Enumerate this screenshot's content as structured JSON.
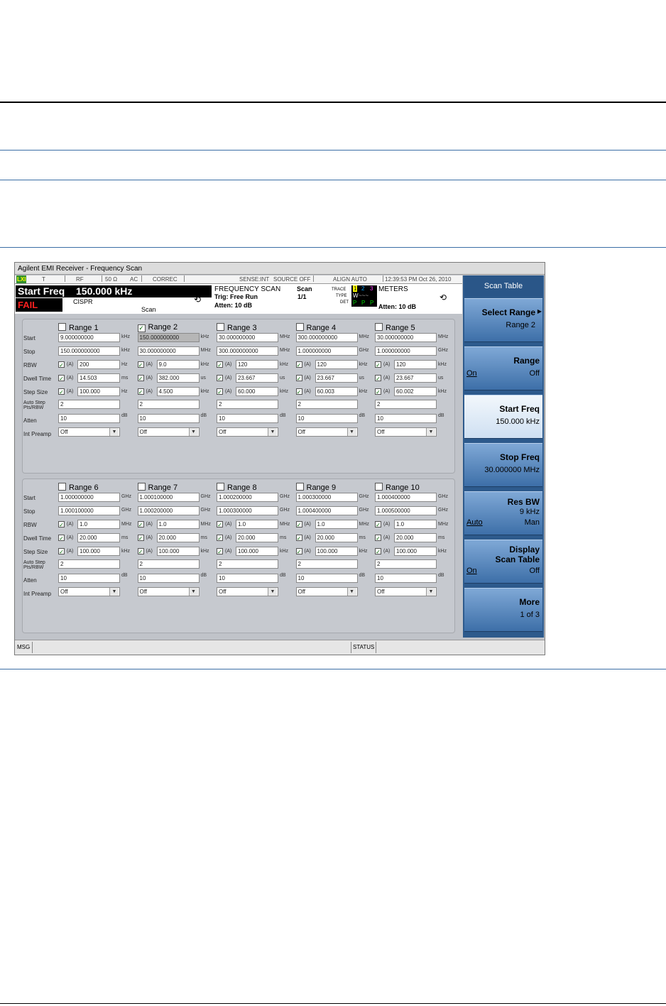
{
  "window": {
    "title": "Agilent EMI Receiver - Frequency Scan"
  },
  "status_line": {
    "lxi": "LXI",
    "t": "T",
    "rf": "RF",
    "imp": "50 Ω",
    "ac": "AC",
    "correc": "CORREC",
    "sense": "SENSE:INT",
    "source": "SOURCE OFF",
    "align": "ALIGN AUTO",
    "time": "12:39:53 PM Oct 26, 2010"
  },
  "header": {
    "active_function": "Start Freq",
    "active_value": "150.000 kHz",
    "fail": "FAIL",
    "cispr": "CISPR",
    "scan_label": "Scan",
    "mode": "FREQUENCY SCAN",
    "trig": "Trig: Free Run",
    "atten": "Atten: 10 dB",
    "scan_head": "Scan",
    "scan_count": "1/1",
    "trace_lbl": "TRACE",
    "type_lbl": "TYPE",
    "det_lbl": "DET",
    "trace_nums": [
      "1",
      "2",
      "3"
    ],
    "type_vals": "W",
    "det_vals": [
      "P",
      "P",
      "P"
    ],
    "meters": "METERS",
    "meters_atten": "Atten: 10 dB",
    "colors": {
      "trace1": "#ffff00",
      "trace2": "#00a2ff",
      "trace3": "#ff40ff",
      "fail": "#ff2020"
    }
  },
  "row_labels": {
    "start": "Start",
    "stop": "Stop",
    "rbw": "RBW",
    "dwell": "Dwell Time",
    "step": "Step Size",
    "auto_step_1": "Auto Step",
    "auto_step_2": "Pts/RBW",
    "atten": "Atten",
    "preamp": "Int Preamp",
    "auto_a": "(A)"
  },
  "ranges_top": [
    {
      "name": "Range 1",
      "checked": "",
      "start": "9.000000000",
      "start_u": "kHz",
      "stop": "150.000000000",
      "stop_u": "kHz",
      "rbw": "200",
      "rbw_u": "Hz",
      "dwell": "14.503",
      "dwell_u": "ms",
      "step": "100.000",
      "step_u": "Hz",
      "pts": "2",
      "atten": "10",
      "atten_u": "dB",
      "preamp": "Off"
    },
    {
      "name": "Range 2",
      "checked": "✓",
      "start": "150.000000000",
      "start_u": "kHz",
      "stop": "30.000000000",
      "stop_u": "MHz",
      "rbw": "9.0",
      "rbw_u": "kHz",
      "dwell": "382.000",
      "dwell_u": "us",
      "step": "4.500",
      "step_u": "kHz",
      "pts": "2",
      "atten": "10",
      "atten_u": "dB",
      "preamp": "Off"
    },
    {
      "name": "Range 3",
      "checked": "",
      "start": "30.000000000",
      "start_u": "MHz",
      "stop": "300.000000000",
      "stop_u": "MHz",
      "rbw": "120",
      "rbw_u": "kHz",
      "dwell": "23.667",
      "dwell_u": "us",
      "step": "60.000",
      "step_u": "kHz",
      "pts": "2",
      "atten": "10",
      "atten_u": "dB",
      "preamp": "Off"
    },
    {
      "name": "Range 4",
      "checked": "",
      "start": "300.000000000",
      "start_u": "MHz",
      "stop": "1.000000000",
      "stop_u": "GHz",
      "rbw": "120",
      "rbw_u": "kHz",
      "dwell": "23.667",
      "dwell_u": "us",
      "step": "60.003",
      "step_u": "kHz",
      "pts": "2",
      "atten": "10",
      "atten_u": "dB",
      "preamp": "Off"
    },
    {
      "name": "Range 5",
      "checked": "",
      "start": "30.000000000",
      "start_u": "MHz",
      "stop": "1.000000000",
      "stop_u": "GHz",
      "rbw": "120",
      "rbw_u": "kHz",
      "dwell": "23.667",
      "dwell_u": "us",
      "step": "60.002",
      "step_u": "kHz",
      "pts": "2",
      "atten": "10",
      "atten_u": "dB",
      "preamp": "Off"
    }
  ],
  "ranges_bottom": [
    {
      "name": "Range 6",
      "checked": "",
      "start": "1.000000000",
      "start_u": "GHz",
      "stop": "1.000100000",
      "stop_u": "GHz",
      "rbw": "1.0",
      "rbw_u": "MHz",
      "dwell": "20.000",
      "dwell_u": "ms",
      "step": "100.000",
      "step_u": "kHz",
      "pts": "2",
      "atten": "10",
      "atten_u": "dB",
      "preamp": "Off"
    },
    {
      "name": "Range 7",
      "checked": "",
      "start": "1.000100000",
      "start_u": "GHz",
      "stop": "1.000200000",
      "stop_u": "GHz",
      "rbw": "1.0",
      "rbw_u": "MHz",
      "dwell": "20.000",
      "dwell_u": "ms",
      "step": "100.000",
      "step_u": "kHz",
      "pts": "2",
      "atten": "10",
      "atten_u": "dB",
      "preamp": "Off"
    },
    {
      "name": "Range 8",
      "checked": "",
      "start": "1.000200000",
      "start_u": "GHz",
      "stop": "1.000300000",
      "stop_u": "GHz",
      "rbw": "1.0",
      "rbw_u": "MHz",
      "dwell": "20.000",
      "dwell_u": "ms",
      "step": "100.000",
      "step_u": "kHz",
      "pts": "2",
      "atten": "10",
      "atten_u": "dB",
      "preamp": "Off"
    },
    {
      "name": "Range 9",
      "checked": "",
      "start": "1.000300000",
      "start_u": "GHz",
      "stop": "1.000400000",
      "stop_u": "GHz",
      "rbw": "1.0",
      "rbw_u": "MHz",
      "dwell": "20.000",
      "dwell_u": "ms",
      "step": "100.000",
      "step_u": "kHz",
      "pts": "2",
      "atten": "10",
      "atten_u": "dB",
      "preamp": "Off"
    },
    {
      "name": "Range 10",
      "checked": "",
      "start": "1.000400000",
      "start_u": "GHz",
      "stop": "1.000500000",
      "stop_u": "GHz",
      "rbw": "1.0",
      "rbw_u": "MHz",
      "dwell": "20.000",
      "dwell_u": "ms",
      "step": "100.000",
      "step_u": "kHz",
      "pts": "2",
      "atten": "10",
      "atten_u": "dB",
      "preamp": "Off"
    }
  ],
  "softkeys": {
    "header": "Scan Table",
    "select_range": {
      "label": "Select Range",
      "value": "Range 2"
    },
    "range": {
      "label": "Range",
      "on": "On",
      "off": "Off"
    },
    "start_freq": {
      "label": "Start Freq",
      "value": "150.000 kHz"
    },
    "stop_freq": {
      "label": "Stop Freq",
      "value": "30.000000 MHz"
    },
    "res_bw": {
      "label": "Res BW",
      "value": "9 kHz",
      "auto": "Auto",
      "man": "Man"
    },
    "display": {
      "label1": "Display",
      "label2": "Scan Table",
      "on": "On",
      "off": "Off"
    },
    "more": {
      "label": "More",
      "value": "1 of 3"
    }
  },
  "msgbar": {
    "msg": "MSG",
    "status": "STATUS"
  }
}
